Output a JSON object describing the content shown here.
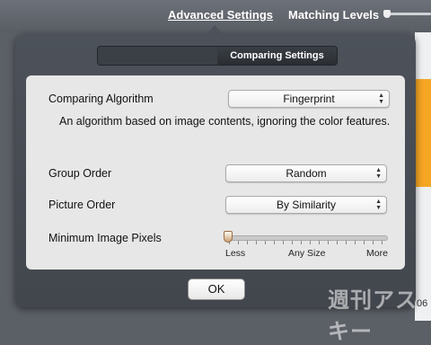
{
  "topbar": {
    "advanced_settings": "Advanced Settings",
    "matching_levels": "Matching Levels"
  },
  "segmented": {
    "active": "Comparing Settings"
  },
  "settings": {
    "algorithm_label": "Comparing Algorithm",
    "algorithm_value": "Fingerprint",
    "algorithm_description": "An algorithm based on image contents, ignoring the color features.",
    "group_order_label": "Group Order",
    "group_order_value": "Random",
    "picture_order_label": "Picture Order",
    "picture_order_value": "By Similarity",
    "min_pixels_label": "Minimum Image Pixels",
    "slider_less": "Less",
    "slider_any": "Any Size",
    "slider_more": "More",
    "slider_level": 0
  },
  "ok_label": "OK",
  "background": {
    "right_edge_text": "06",
    "watermark": "週刊アスキー"
  }
}
